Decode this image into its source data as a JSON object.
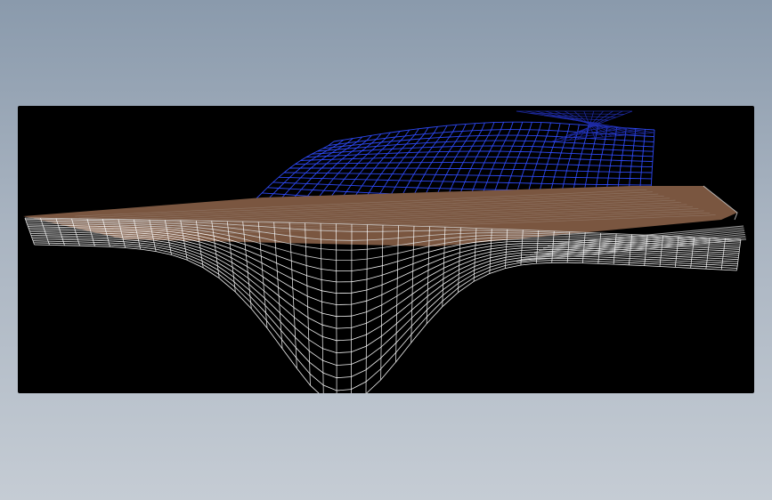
{
  "viewport": {
    "background": "#000000",
    "layers": [
      {
        "surface": "upper-mesh",
        "color": "#2f4cff"
      },
      {
        "surface": "middle-surface",
        "color": "#7a5640"
      },
      {
        "surface": "lower-mesh",
        "color": "#ffffff"
      }
    ]
  }
}
